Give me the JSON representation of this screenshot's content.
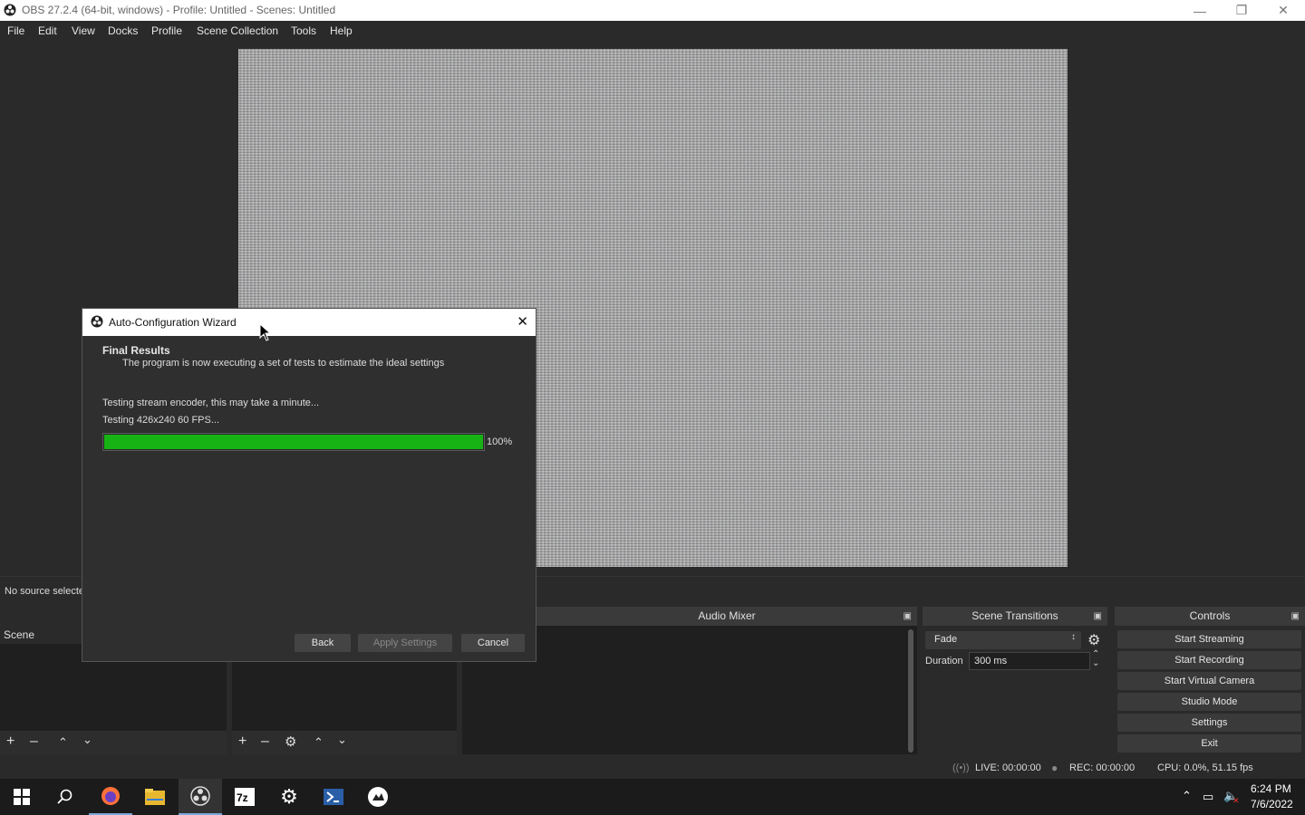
{
  "window": {
    "title": "OBS 27.2.4 (64-bit, windows) - Profile: Untitled - Scenes: Untitled",
    "minimize_icon": "minimize-icon",
    "restore_icon": "restore-icon",
    "close_icon": "close-icon"
  },
  "menu": [
    "File",
    "Edit",
    "View",
    "Docks",
    "Profile",
    "Scene Collection",
    "Tools",
    "Help"
  ],
  "source_bar": {
    "text": "No source selecte"
  },
  "docks": {
    "scenes": {
      "title": "Scene"
    },
    "audio_mixer": {
      "title": "Audio Mixer"
    },
    "scene_transitions": {
      "title": "Scene Transitions",
      "transition": "Fade",
      "duration_label": "Duration",
      "duration_value": "300 ms"
    },
    "controls": {
      "title": "Controls",
      "buttons": [
        "Start Streaming",
        "Start Recording",
        "Start Virtual Camera",
        "Studio Mode",
        "Settings",
        "Exit"
      ]
    }
  },
  "status": {
    "live": "LIVE: 00:00:00",
    "rec": "REC: 00:00:00",
    "cpu": "CPU: 0.0%, 51.15 fps"
  },
  "dialog": {
    "title": "Auto-Configuration Wizard",
    "heading": "Final Results",
    "subheading": "The program is now executing a set of tests to estimate the ideal settings",
    "line1": "Testing stream encoder, this may take a minute...",
    "line2": "Testing 426x240 60 FPS...",
    "progress": 100,
    "progress_label": "100%",
    "buttons": {
      "back": "Back",
      "apply": "Apply Settings",
      "cancel": "Cancel"
    }
  },
  "taskbar": {
    "time": "6:24 PM",
    "date": "7/6/2022",
    "icons": [
      "start-icon",
      "search-icon",
      "firefox-icon",
      "file-explorer-icon",
      "obs-icon",
      "7zip-icon",
      "settings-icon",
      "powershell-icon",
      "xbox-icon"
    ]
  },
  "colors": {
    "accent_green": "#17b314",
    "background": "#2a2a2a"
  }
}
